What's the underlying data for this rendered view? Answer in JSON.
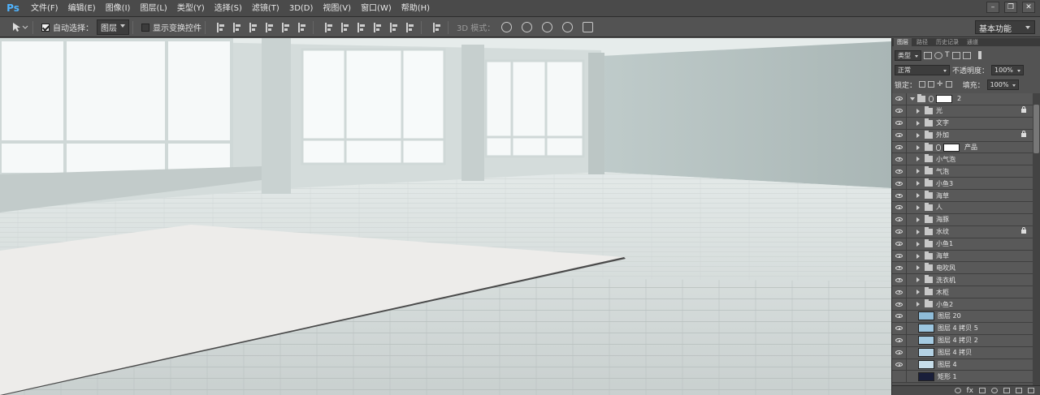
{
  "app": {
    "logo": "Ps"
  },
  "menu": [
    "文件(F)",
    "编辑(E)",
    "图像(I)",
    "图层(L)",
    "类型(Y)",
    "选择(S)",
    "滤镜(T)",
    "3D(D)",
    "视图(V)",
    "窗口(W)",
    "帮助(H)"
  ],
  "options": {
    "auto_select_label": "自动选择：",
    "auto_select_value": "图层",
    "show_transform_label": "显示变换控件",
    "mode_3d_label": "3D 模式：",
    "workspace": "基本功能"
  },
  "panel": {
    "tabs": [
      "图层",
      "路径",
      "历史记录",
      "通道"
    ],
    "filter_kind": "类型",
    "blend_mode": "正常",
    "opacity_label": "不透明度：",
    "opacity_value": "100%",
    "lock_label": "锁定：",
    "fill_label": "填充：",
    "fill_value": "100%"
  },
  "layers": [
    {
      "name": "2",
      "type": "group",
      "open": true,
      "mask": true,
      "visible": true,
      "locked": false
    },
    {
      "name": "光",
      "type": "group",
      "visible": true,
      "locked": true
    },
    {
      "name": "文字",
      "type": "group",
      "visible": true,
      "locked": false
    },
    {
      "name": "外加",
      "type": "group",
      "visible": true,
      "locked": true
    },
    {
      "name": "产品",
      "type": "group",
      "mask": true,
      "visible": true,
      "locked": false
    },
    {
      "name": "小气泡",
      "type": "group",
      "visible": true,
      "locked": false
    },
    {
      "name": "气泡",
      "type": "group",
      "visible": true,
      "locked": false
    },
    {
      "name": "小鱼3",
      "type": "group",
      "visible": true,
      "locked": false
    },
    {
      "name": "海草",
      "type": "group",
      "visible": true,
      "locked": false
    },
    {
      "name": "人",
      "type": "group",
      "visible": true,
      "locked": false
    },
    {
      "name": "海豚",
      "type": "group",
      "visible": true,
      "locked": false
    },
    {
      "name": "水纹",
      "type": "group",
      "visible": true,
      "locked": true
    },
    {
      "name": "小鱼1",
      "type": "group",
      "visible": true,
      "locked": false
    },
    {
      "name": "海草",
      "type": "group",
      "visible": true,
      "locked": false
    },
    {
      "name": "电吹风",
      "type": "group",
      "visible": true,
      "locked": false
    },
    {
      "name": "洗衣机",
      "type": "group",
      "visible": true,
      "locked": false
    },
    {
      "name": "木柜",
      "type": "group",
      "visible": true,
      "locked": false
    },
    {
      "name": "小鱼2",
      "type": "group",
      "visible": true,
      "locked": false
    },
    {
      "name": "图层 20",
      "type": "pixel",
      "thumb": "#8fbcd8",
      "visible": true,
      "locked": false
    },
    {
      "name": "图层 4 拷贝 5",
      "type": "pixel",
      "thumb": "#9cc6e0",
      "visible": true,
      "locked": false
    },
    {
      "name": "图层 4 拷贝 2",
      "type": "pixel",
      "thumb": "#a5cbe2",
      "visible": true,
      "locked": false
    },
    {
      "name": "图层 4 拷贝",
      "type": "pixel",
      "thumb": "#b4d2e4",
      "visible": true,
      "locked": false
    },
    {
      "name": "图层 4",
      "type": "pixel",
      "thumb": "#c7dde9",
      "visible": true,
      "locked": false
    },
    {
      "name": "矩形 1",
      "type": "pixel",
      "thumb": "#1a1f3a",
      "visible": false,
      "locked": false
    }
  ]
}
